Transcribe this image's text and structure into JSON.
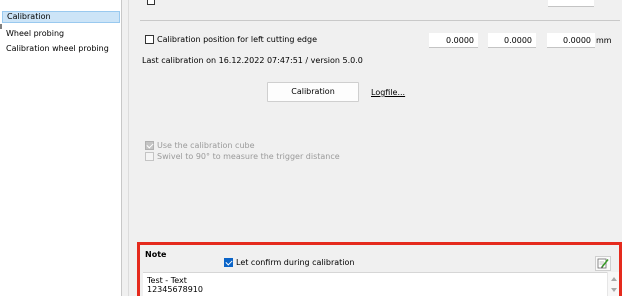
{
  "nav": {
    "items": [
      {
        "label": "Calibration",
        "selected": true
      },
      {
        "label": "Wheel probing",
        "selected": false
      },
      {
        "label": "Calibration wheel probing",
        "selected": false
      }
    ]
  },
  "calibration": {
    "left_edge_label": "Calibration position for left cutting edge",
    "values": [
      "0.0000",
      "0.0000",
      "0.0000"
    ],
    "unit": "mm",
    "last_calibration": "Last calibration on 16.12.2022 07:47:51 / version 5.0.0",
    "button_label": "Calibration",
    "logfile_label": "Logfile...",
    "use_cube_label": "Use the calibration cube",
    "use_cube_checked": true,
    "swivel_label": "Swivel to 90° to measure the trigger distance",
    "swivel_checked": false
  },
  "note": {
    "title": "Note",
    "confirm_label": "Let confirm during calibration",
    "confirm_checked": true,
    "text_line1": "Test - Text",
    "text_line2": "12345678910",
    "edit_icon": "edit-note-icon"
  },
  "colors": {
    "highlight_border": "#e52a1d",
    "selection": "#cce4f7",
    "checkbox_accent": "#0a64c8"
  }
}
